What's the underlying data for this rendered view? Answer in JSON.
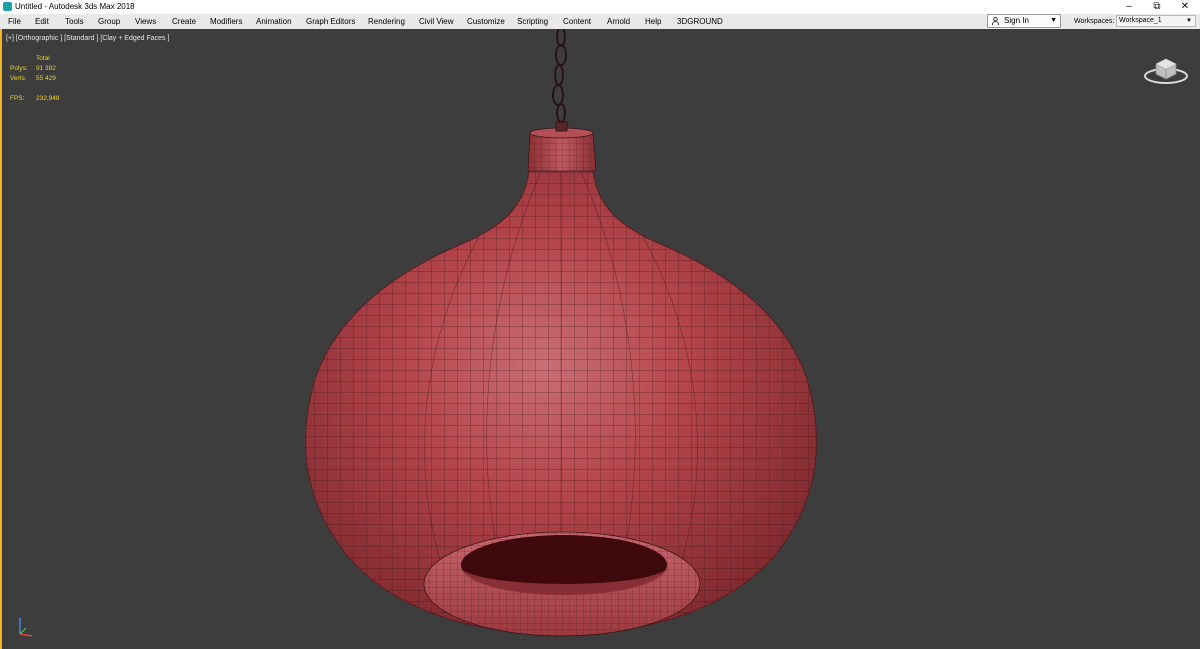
{
  "window": {
    "title": "Untitled - Autodesk 3ds Max 2018",
    "buttons": {
      "minimize": "–",
      "restore": "⧉",
      "close": "✕"
    }
  },
  "menu": {
    "items": [
      "File",
      "Edit",
      "Tools",
      "Group",
      "Views",
      "Create",
      "Modifiers",
      "Animation",
      "Graph Editors",
      "Rendering",
      "Civil View",
      "Customize",
      "Scripting",
      "Content",
      "Arnold",
      "Help",
      "3DGROUND"
    ]
  },
  "signin": {
    "label": "Sign In",
    "icon": "person-icon"
  },
  "workspace": {
    "label": "Workspaces:",
    "value": "Workspace_1"
  },
  "viewport": {
    "label": "[+] [Orthographic ] [Standard ] [Clay + Edged Faces ]",
    "active_border_color": "#f0b429"
  },
  "stats": {
    "header": "Total",
    "polys_label": "Polys:",
    "polys_value": "91 392",
    "verts_label": "Verts:",
    "verts_value": "55 429",
    "fps_label": "FPS:",
    "fps_value": "232,948",
    "color": "#f2d22a"
  },
  "scene": {
    "object": "pendant-lamp",
    "clay_color": "#b8454b",
    "wire_color": "#3a1518"
  }
}
